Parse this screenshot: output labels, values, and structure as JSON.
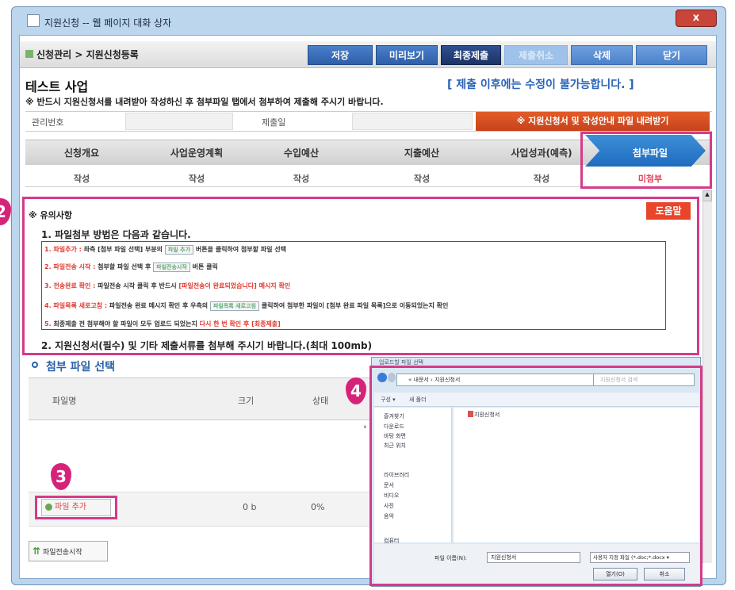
{
  "window": {
    "title": "지원신청 -- 웹 페이지 대화 상자",
    "close_label": "x"
  },
  "toolbar": {
    "breadcrumb": "신청관리 > 지원신청등록",
    "save": "저장",
    "preview": "미리보기",
    "final_submit": "최종제출",
    "cancel_submit": "제출취소",
    "delete": "삭제",
    "close": "닫기"
  },
  "header": {
    "title": "테스트 사업",
    "notice": "[ 제출 이후에는 수정이 불가능합니다. ]",
    "instruction": "※ 반드시 지원신청서를 내려받아 작성하신 후 첨부파일 탭에서 첨부하여 제출해 주시기 바랍니다.",
    "mgmt_no_label": "관리번호",
    "submit_date_label": "제출일",
    "download_button": "※ 지원신청서 및 작성안내 파일 내려받기"
  },
  "tabs": [
    {
      "label": "신청개요",
      "status": "작성"
    },
    {
      "label": "사업운영계획",
      "status": "작성"
    },
    {
      "label": "수입예산",
      "status": "작성"
    },
    {
      "label": "지출예산",
      "status": "작성"
    },
    {
      "label": "사업성과(예측)",
      "status": "작성"
    },
    {
      "label": "첨부파일",
      "status": "미첨부"
    }
  ],
  "guide": {
    "heading": "※ 유의사항",
    "help_button": "도움말",
    "h1": "1. 파일첨부 방법은 다음과 같습니다.",
    "steps": [
      {
        "key": "1. 파일추가 :",
        "text": "좌측 [첨부 파일 선택] 부분의",
        "btn": "파일 추가",
        "tail": "버튼을 클릭하여 첨부할 파일 선택"
      },
      {
        "key": "2. 파일전송 시작 :",
        "text": "첨부할 파일 선택 후",
        "btn": "파일전송시작",
        "tail": "버튼 클릭"
      },
      {
        "key": "3. 전송완료 확인 :",
        "text": "파일전송 시작 클릭 후 반드시",
        "btn": "",
        "tail": "[파일전송이 완료되었습니다] 메시지 확인"
      },
      {
        "key": "4. 파일목록 새로고침 :",
        "text": "파일전송 완료 메시지 확인 후 우측의",
        "btn": "파일목록 새로고침",
        "tail": "클릭하여 첨부한 파일이 [첨부 완료 파일 목록]으로 이동되었는지 확인"
      },
      {
        "key": "5.",
        "text": "최종제출 전 첨부해야 할 파일이 모두 업로드 되었는지",
        "btn": "",
        "tail": "다시 한 번 확인 후 [최종제출]"
      }
    ],
    "h2": "2. 지원신청서(필수) 및 기타 제출서류를 첨부해 주시기 바랍니다.(최대 100mb)"
  },
  "file_section": {
    "title": "첨부 파일 선택",
    "col_name": "파일명",
    "col_size": "크기",
    "col_status": "상태",
    "add_file": "파일 추가",
    "row_size": "0 b",
    "row_status": "0%",
    "upload_start": "파일전송시작"
  },
  "badges": {
    "b2": "2",
    "b3": "3",
    "b4": "4"
  },
  "dialog": {
    "title": "업로드할 파일 선택",
    "address": "« 내문서 › 지원신청서",
    "search_placeholder": "지원신청서 검색",
    "organize": "구성 ▾",
    "new_folder": "새 폴더",
    "nav": [
      "즐겨찾기",
      "다운로드",
      "바탕 화면",
      "최근 위치",
      "라이브러리",
      "문서",
      "비디오",
      "사진",
      "음악",
      "컴퓨터"
    ],
    "file": "지원신청서",
    "filename_label": "파일 이름(N):",
    "filename_value": "지원신청서",
    "filter": "사용자 지정 파일 (*.doc;*.docx ▾",
    "open": "열기(O)",
    "cancel": "취소"
  },
  "colors": {
    "accent": "#2e5fa8",
    "highlight": "#d63a8a",
    "alert": "#e0392e"
  }
}
